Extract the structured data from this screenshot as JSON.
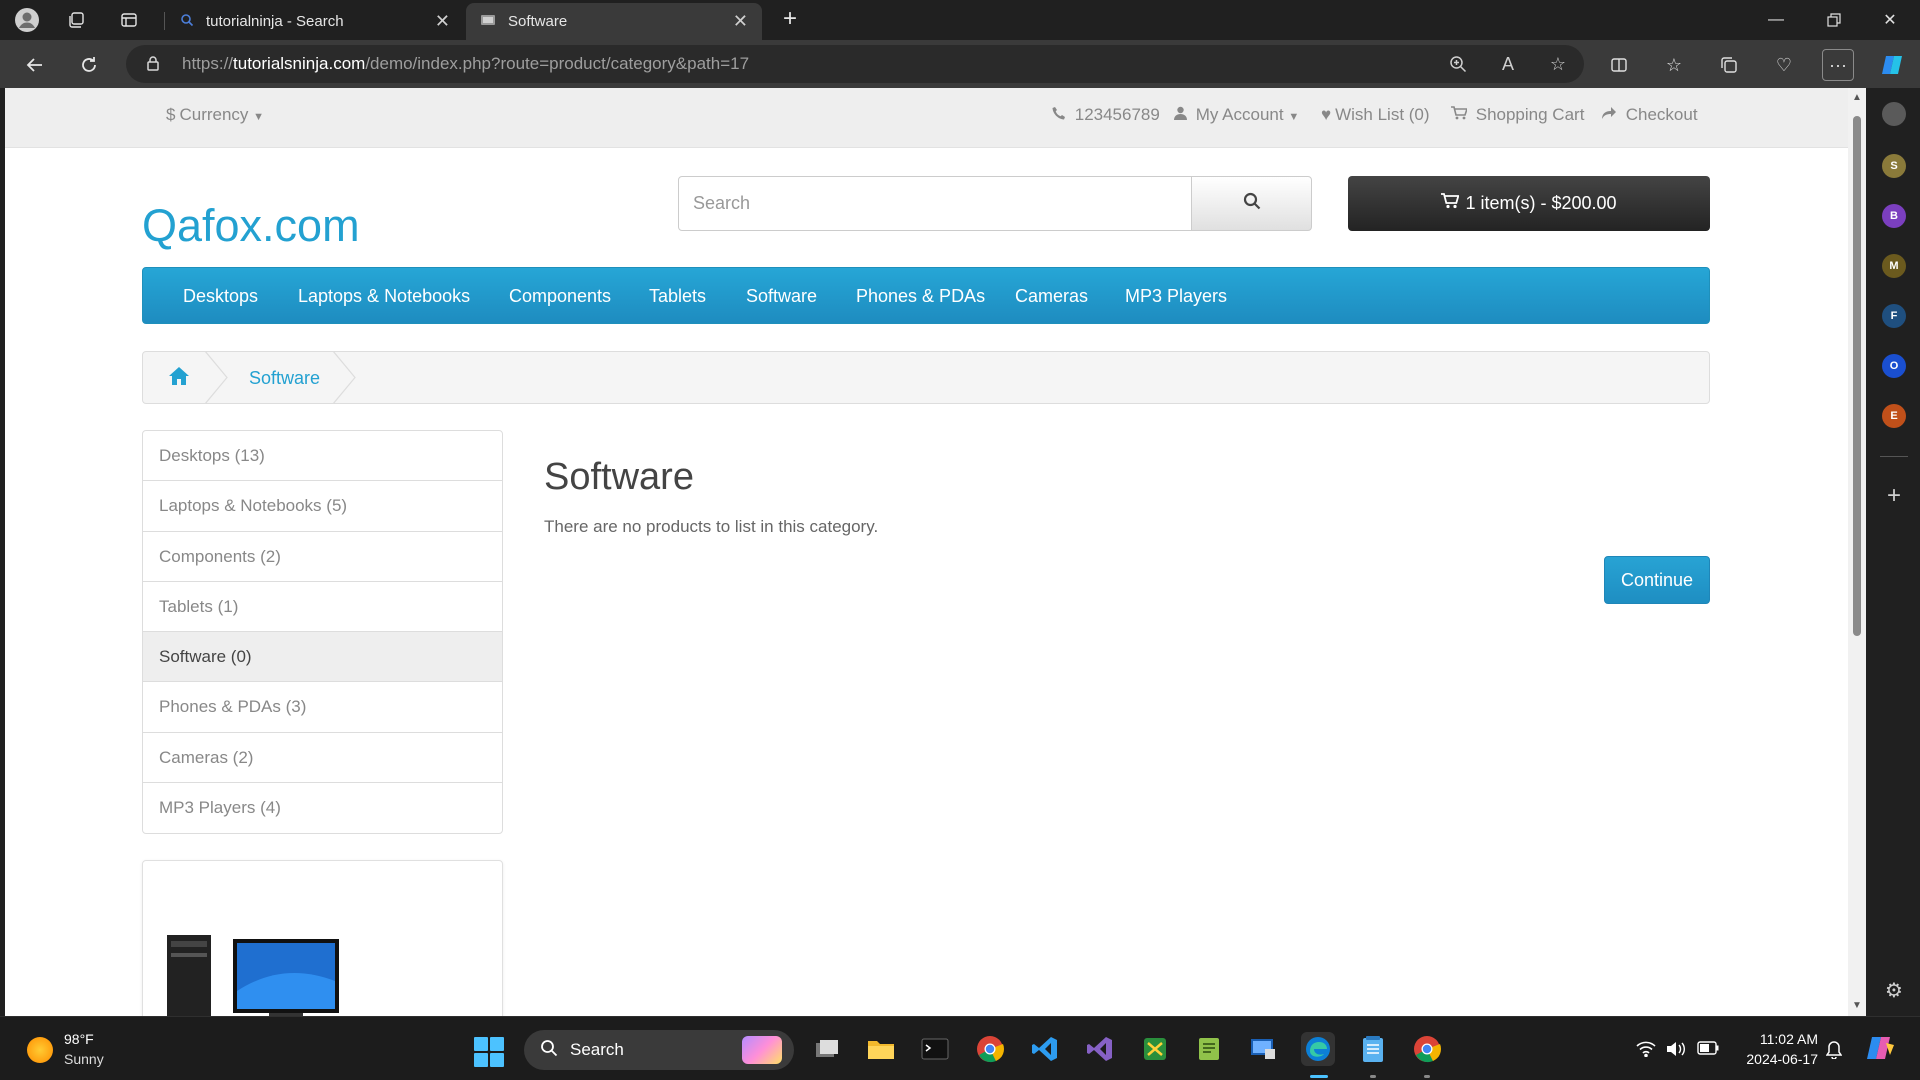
{
  "browser": {
    "tabs": [
      {
        "label": "tutorialninja - Search",
        "active": false
      },
      {
        "label": "Software",
        "active": true
      }
    ],
    "url": {
      "prefix": "https://",
      "host": "tutorialsninja.com",
      "path": "/demo/index.php?route=product/category&path=17"
    },
    "sidebar_profiles": [
      {
        "letter": "S",
        "color": "#8a7a3a"
      },
      {
        "letter": "B",
        "color": "#7b3fbf"
      },
      {
        "letter": "M",
        "color": "#6b5a1e"
      },
      {
        "letter": "F",
        "color": "#1f4f7f"
      },
      {
        "letter": "O",
        "color": "#1a4fd0"
      },
      {
        "letter": "E",
        "color": "#c0501a"
      }
    ]
  },
  "topbar": {
    "currency": "Currency",
    "phone": "123456789",
    "my_account": "My Account",
    "wish_list": "Wish List (0)",
    "shopping_cart": "Shopping Cart",
    "checkout": "Checkout"
  },
  "header": {
    "logo": "Qafox.com",
    "search_placeholder": "Search",
    "cart_label": "1 item(s) - $200.00"
  },
  "menu": [
    "Desktops",
    "Laptops & Notebooks",
    "Components",
    "Tablets",
    "Software",
    "Phones & PDAs",
    "Cameras",
    "MP3 Players"
  ],
  "breadcrumb": {
    "current": "Software"
  },
  "sidebar": {
    "items": [
      {
        "label": "Desktops (13)",
        "active": false
      },
      {
        "label": "Laptops & Notebooks (5)",
        "active": false
      },
      {
        "label": "Components (2)",
        "active": false
      },
      {
        "label": "Tablets (1)",
        "active": false
      },
      {
        "label": "Software (0)",
        "active": true
      },
      {
        "label": "Phones & PDAs (3)",
        "active": false
      },
      {
        "label": "Cameras (2)",
        "active": false
      },
      {
        "label": "MP3 Players (4)",
        "active": false
      }
    ]
  },
  "content": {
    "title": "Software",
    "message": "There are no products to list in this category.",
    "continue_label": "Continue"
  },
  "taskbar": {
    "weather_temp": "98°F",
    "weather_desc": "Sunny",
    "search_label": "Search",
    "time": "11:02 AM",
    "date": "2024-06-17"
  },
  "colors": {
    "link": "#23a1d1",
    "menu_bg": "#229ac8",
    "cart_bg": "#303030",
    "taskbar_accent": "#4cc2ff"
  }
}
